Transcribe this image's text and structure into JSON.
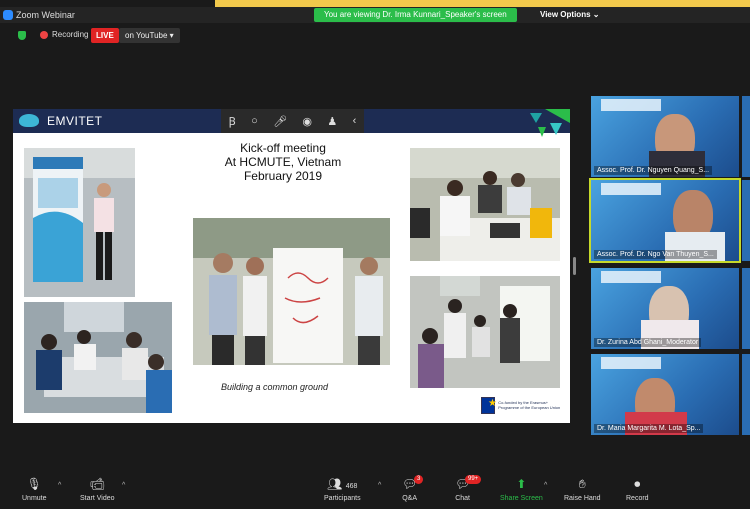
{
  "window": {
    "title": "Zoom Webinar",
    "viewing_banner": "You are viewing Dr. Irma Kunnari_Speaker's screen",
    "view_options": "View Options"
  },
  "status": {
    "recording_label": "Recording",
    "live_badge": "LIVE",
    "stream_target": "on YouTube"
  },
  "slide": {
    "brand": "EMVITET",
    "title_lines": [
      "Kick-off meeting",
      "At HCMUTE, Vietnam",
      "February 2019"
    ],
    "caption": "Building a common ground",
    "eu_text": "Co-funded by the Erasmus+ Programme of the European Union",
    "toolbar_icons": [
      "draw-icon",
      "circle-icon",
      "mic-icon",
      "record-icon",
      "stamp-icon",
      "back-icon"
    ]
  },
  "participants_panel": {
    "tiles": [
      {
        "name": "Assoc. Prof. Dr. Nguyen Quang_S..."
      },
      {
        "name": "Assoc. Prof. Dr. Ngo Van Thuyen_S..."
      },
      {
        "name": "Dr. Zurina Abd Ghani_Moderator"
      },
      {
        "name": "Dr. Maria Margarita M. Lota_Sp..."
      }
    ]
  },
  "toolbar": {
    "unmute": "Unmute",
    "start_video": "Start Video",
    "participants": "Participants",
    "participants_count": "468",
    "qa": "Q&A",
    "qa_badge": "3",
    "chat": "Chat",
    "chat_badge": "99+",
    "share_screen": "Share Screen",
    "raise_hand": "Raise Hand",
    "record": "Record"
  },
  "colors": {
    "zoom_blue": "#2d8cff",
    "share_green": "#2bbd4a",
    "live_red": "#e02424",
    "slide_header": "#1d2c53"
  }
}
